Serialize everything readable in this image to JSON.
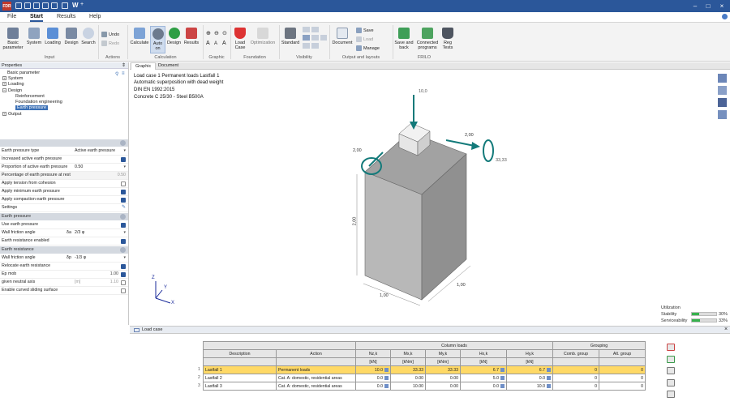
{
  "app": {
    "logo": "FDR",
    "title_items": [
      "W",
      "+"
    ]
  },
  "menu": {
    "tabs": [
      "File",
      "Start",
      "Results",
      "Help"
    ],
    "active": "Start"
  },
  "ribbon": {
    "input": {
      "buttons": [
        "Basic parameter",
        "System",
        "Loading",
        "Design",
        "Search"
      ],
      "label": "Input"
    },
    "actions": {
      "undo": "Undo",
      "redo": "Redo",
      "label": "Actions"
    },
    "calculation": {
      "buttons": [
        "Calculate",
        "Auto on",
        "Design",
        "Results"
      ],
      "label": "Calculation"
    },
    "graphic": {
      "label": "Graphic"
    },
    "foundation": {
      "buttons": [
        "Load Case",
        "Optimization"
      ],
      "label": "Foundation"
    },
    "visibility": {
      "buttons": [
        "Standard"
      ],
      "label": "Visibility"
    },
    "output": {
      "buttons": [
        "Document",
        "Save",
        "Load",
        "Manage"
      ],
      "label": "Output and layouts"
    },
    "frilo": {
      "buttons": [
        "Save and back",
        "Connected programs",
        "Reg Tests"
      ],
      "label": "FRILO"
    }
  },
  "properties": {
    "header": "Properties",
    "tree": [
      "Basic parameter",
      "System",
      "Loading",
      "Design",
      "Reinforcement",
      "Foundation engineering",
      "Earth pressure",
      "Output"
    ],
    "rows": [
      {
        "label": "Earth pressure type",
        "value": "Active earth pressure"
      },
      {
        "label": "Increased active earth pressure",
        "check": true
      },
      {
        "label": "Proportion of active earth pressure",
        "value": "0.50"
      },
      {
        "label": "Percentage of earth pressure at rest",
        "value": "0.50"
      },
      {
        "label": "Apply tension from cohesion",
        "check": false
      },
      {
        "label": "Apply minimum earth pressure",
        "check": true
      },
      {
        "label": "Apply compaction earth pressure",
        "check": true
      },
      {
        "label": "Settings"
      }
    ],
    "sec_earth_pressure": "Earth pressure",
    "rows2": [
      {
        "label": "Use earth pressure",
        "check": true
      },
      {
        "label": "Wall friction angle",
        "sym": "δa",
        "value": "2/3 φ"
      },
      {
        "label": "Earth resistance enabled",
        "check": true
      }
    ],
    "sec_earth_resistance": "Earth resistance",
    "rows3": [
      {
        "label": "Wall friction angle",
        "sym": "δp",
        "value": "-1/3 φ"
      },
      {
        "label": "Relocate earth resistance",
        "check": true
      },
      {
        "label": "Ep mob",
        "value": "1.00"
      },
      {
        "label": "given neutral axis",
        "value": "1.10",
        "unit": "[m]"
      },
      {
        "label": "Enable curved sliding surface",
        "check": false
      }
    ]
  },
  "graphic_tabs": [
    "Graphic",
    "Document"
  ],
  "graphic_info": [
    "Load case 1 Permanent loads Lastfall 1",
    "Automatic superposition with dead weight",
    "DIN EN 1992:2015",
    "Concrete C 25/30 - Steel B500A"
  ],
  "model": {
    "load_top": "10,0",
    "my_right": "2,00",
    "my_left": "2,00",
    "side_value": "33,33",
    "height": "2,00",
    "width": "1,00",
    "depth": "1,00",
    "axes": [
      "X",
      "Y",
      "Z"
    ]
  },
  "utilization": {
    "title": "Utilization",
    "items": [
      {
        "label": "Stability",
        "value": "30%",
        "fraction": 0.3
      },
      {
        "label": "Serviceability",
        "value": "33%",
        "fraction": 0.33
      }
    ]
  },
  "loadcase": {
    "tab": "Load case",
    "group_headers": {
      "column_loads": "Column loads",
      "grouping": "Grouping"
    },
    "headers": [
      "Description",
      "Action",
      "Nz,k",
      "Mx,k",
      "My,k",
      "Hx,k",
      "Hy,k",
      "Comb. group",
      "Alt. group"
    ],
    "units": [
      "",
      "",
      "[kN]",
      "[kNm]",
      "[kNm]",
      "[kN]",
      "[kN]",
      "",
      ""
    ],
    "rows": [
      {
        "n": "1",
        "desc": "Lastfall 1",
        "action": "Permanent loads",
        "nz": "10.0",
        "mx": "33.33",
        "my": "33.33",
        "hx": "6.7",
        "hy": "6.7",
        "comb": "0",
        "alt": "0"
      },
      {
        "n": "2",
        "desc": "Lastfall 2",
        "action": "Cat. A: domestic, residential areas",
        "nz": "0.0",
        "mx": "0.00",
        "my": "0.00",
        "hx": "5.0",
        "hy": "0.0",
        "comb": "0",
        "alt": "0"
      },
      {
        "n": "3",
        "desc": "Lastfall 3",
        "action": "Cat. A: domestic, residential areas",
        "nz": "0.0",
        "mx": "10.00",
        "my": "0.00",
        "hx": "0.0",
        "hy": "10.0",
        "comb": "0",
        "alt": "0"
      }
    ]
  }
}
